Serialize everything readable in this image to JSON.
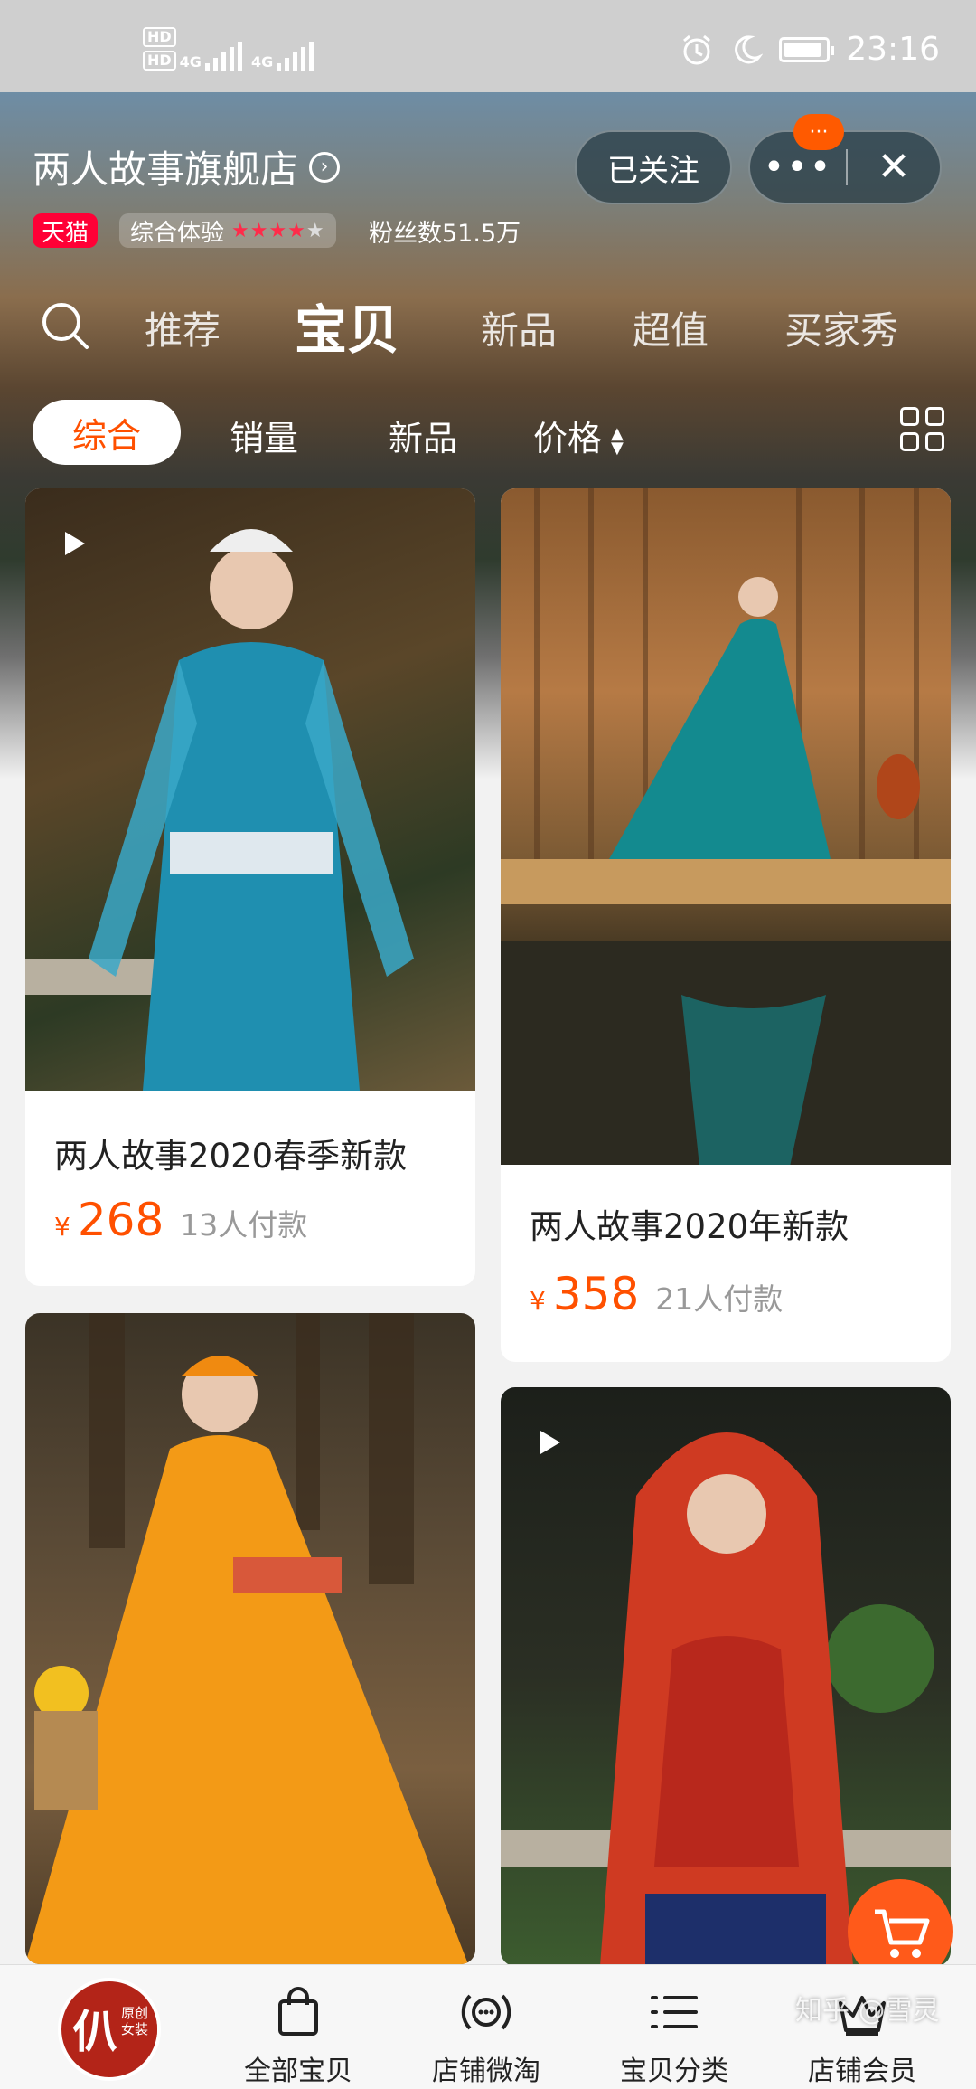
{
  "status_bar": {
    "hd1": "HD",
    "hd2": "HD",
    "net1": "4G",
    "net2": "4G",
    "time": "23:16",
    "icons": [
      "alarm-icon",
      "moon-icon",
      "battery-icon"
    ]
  },
  "store": {
    "name": "两人故事旗舰店",
    "follow_label": "已关注",
    "more_badge": "···",
    "tmall_badge": "天猫",
    "experience_label": "综合体验",
    "rating_stars": 4.5,
    "fans_text": "粉丝数51.5万"
  },
  "tabs": [
    {
      "label": "推荐"
    },
    {
      "label": "宝贝"
    },
    {
      "label": "新品"
    },
    {
      "label": "超值"
    },
    {
      "label": "买家秀"
    }
  ],
  "sort": {
    "options": [
      {
        "label": "综合"
      },
      {
        "label": "销量"
      },
      {
        "label": "新品"
      },
      {
        "label": "价格"
      }
    ]
  },
  "products": [
    {
      "title": "两人故事2020春季新款",
      "currency": "¥",
      "price": "268",
      "buyers": "13人付款",
      "has_video": true
    },
    {
      "title": "两人故事2020年新款",
      "currency": "¥",
      "price": "358",
      "buyers": "21人付款",
      "has_video": false
    },
    {
      "title": "",
      "has_video": false
    },
    {
      "title": "",
      "has_video": true
    }
  ],
  "bottom_nav": {
    "logo_text": "两人故事",
    "logo_sub": "原创女装",
    "items": [
      {
        "label": "全部宝贝",
        "icon": "shopping-bag-icon"
      },
      {
        "label": "店铺微淘",
        "icon": "broadcast-icon"
      },
      {
        "label": "宝贝分类",
        "icon": "category-list-icon"
      },
      {
        "label": "店铺会员",
        "icon": "crown-icon"
      }
    ]
  },
  "watermark": "知乎 @雪灵",
  "colors": {
    "accent": "#ff5000",
    "tmall": "#ff0036"
  }
}
